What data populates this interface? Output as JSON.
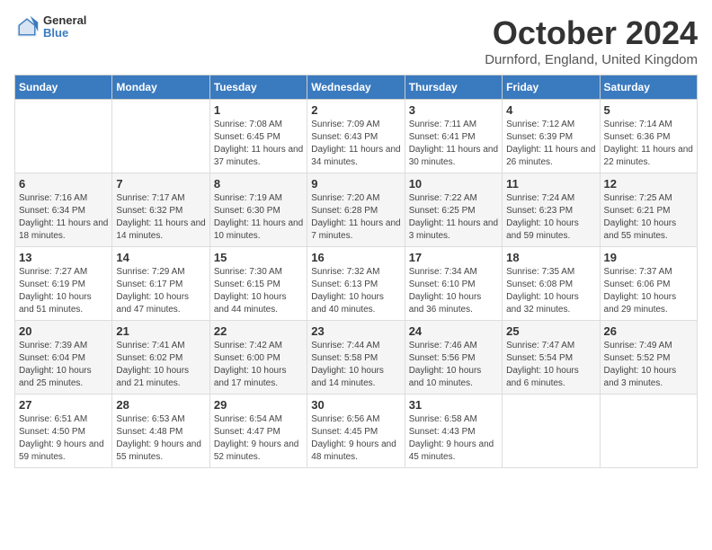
{
  "header": {
    "logo_line1": "General",
    "logo_line2": "Blue",
    "month_title": "October 2024",
    "location": "Durnford, England, United Kingdom"
  },
  "weekdays": [
    "Sunday",
    "Monday",
    "Tuesday",
    "Wednesday",
    "Thursday",
    "Friday",
    "Saturday"
  ],
  "weeks": [
    [
      {
        "day": "",
        "info": ""
      },
      {
        "day": "",
        "info": ""
      },
      {
        "day": "1",
        "info": "Sunrise: 7:08 AM\nSunset: 6:45 PM\nDaylight: 11 hours and 37 minutes."
      },
      {
        "day": "2",
        "info": "Sunrise: 7:09 AM\nSunset: 6:43 PM\nDaylight: 11 hours and 34 minutes."
      },
      {
        "day": "3",
        "info": "Sunrise: 7:11 AM\nSunset: 6:41 PM\nDaylight: 11 hours and 30 minutes."
      },
      {
        "day": "4",
        "info": "Sunrise: 7:12 AM\nSunset: 6:39 PM\nDaylight: 11 hours and 26 minutes."
      },
      {
        "day": "5",
        "info": "Sunrise: 7:14 AM\nSunset: 6:36 PM\nDaylight: 11 hours and 22 minutes."
      }
    ],
    [
      {
        "day": "6",
        "info": "Sunrise: 7:16 AM\nSunset: 6:34 PM\nDaylight: 11 hours and 18 minutes."
      },
      {
        "day": "7",
        "info": "Sunrise: 7:17 AM\nSunset: 6:32 PM\nDaylight: 11 hours and 14 minutes."
      },
      {
        "day": "8",
        "info": "Sunrise: 7:19 AM\nSunset: 6:30 PM\nDaylight: 11 hours and 10 minutes."
      },
      {
        "day": "9",
        "info": "Sunrise: 7:20 AM\nSunset: 6:28 PM\nDaylight: 11 hours and 7 minutes."
      },
      {
        "day": "10",
        "info": "Sunrise: 7:22 AM\nSunset: 6:25 PM\nDaylight: 11 hours and 3 minutes."
      },
      {
        "day": "11",
        "info": "Sunrise: 7:24 AM\nSunset: 6:23 PM\nDaylight: 10 hours and 59 minutes."
      },
      {
        "day": "12",
        "info": "Sunrise: 7:25 AM\nSunset: 6:21 PM\nDaylight: 10 hours and 55 minutes."
      }
    ],
    [
      {
        "day": "13",
        "info": "Sunrise: 7:27 AM\nSunset: 6:19 PM\nDaylight: 10 hours and 51 minutes."
      },
      {
        "day": "14",
        "info": "Sunrise: 7:29 AM\nSunset: 6:17 PM\nDaylight: 10 hours and 47 minutes."
      },
      {
        "day": "15",
        "info": "Sunrise: 7:30 AM\nSunset: 6:15 PM\nDaylight: 10 hours and 44 minutes."
      },
      {
        "day": "16",
        "info": "Sunrise: 7:32 AM\nSunset: 6:13 PM\nDaylight: 10 hours and 40 minutes."
      },
      {
        "day": "17",
        "info": "Sunrise: 7:34 AM\nSunset: 6:10 PM\nDaylight: 10 hours and 36 minutes."
      },
      {
        "day": "18",
        "info": "Sunrise: 7:35 AM\nSunset: 6:08 PM\nDaylight: 10 hours and 32 minutes."
      },
      {
        "day": "19",
        "info": "Sunrise: 7:37 AM\nSunset: 6:06 PM\nDaylight: 10 hours and 29 minutes."
      }
    ],
    [
      {
        "day": "20",
        "info": "Sunrise: 7:39 AM\nSunset: 6:04 PM\nDaylight: 10 hours and 25 minutes."
      },
      {
        "day": "21",
        "info": "Sunrise: 7:41 AM\nSunset: 6:02 PM\nDaylight: 10 hours and 21 minutes."
      },
      {
        "day": "22",
        "info": "Sunrise: 7:42 AM\nSunset: 6:00 PM\nDaylight: 10 hours and 17 minutes."
      },
      {
        "day": "23",
        "info": "Sunrise: 7:44 AM\nSunset: 5:58 PM\nDaylight: 10 hours and 14 minutes."
      },
      {
        "day": "24",
        "info": "Sunrise: 7:46 AM\nSunset: 5:56 PM\nDaylight: 10 hours and 10 minutes."
      },
      {
        "day": "25",
        "info": "Sunrise: 7:47 AM\nSunset: 5:54 PM\nDaylight: 10 hours and 6 minutes."
      },
      {
        "day": "26",
        "info": "Sunrise: 7:49 AM\nSunset: 5:52 PM\nDaylight: 10 hours and 3 minutes."
      }
    ],
    [
      {
        "day": "27",
        "info": "Sunrise: 6:51 AM\nSunset: 4:50 PM\nDaylight: 9 hours and 59 minutes."
      },
      {
        "day": "28",
        "info": "Sunrise: 6:53 AM\nSunset: 4:48 PM\nDaylight: 9 hours and 55 minutes."
      },
      {
        "day": "29",
        "info": "Sunrise: 6:54 AM\nSunset: 4:47 PM\nDaylight: 9 hours and 52 minutes."
      },
      {
        "day": "30",
        "info": "Sunrise: 6:56 AM\nSunset: 4:45 PM\nDaylight: 9 hours and 48 minutes."
      },
      {
        "day": "31",
        "info": "Sunrise: 6:58 AM\nSunset: 4:43 PM\nDaylight: 9 hours and 45 minutes."
      },
      {
        "day": "",
        "info": ""
      },
      {
        "day": "",
        "info": ""
      }
    ]
  ]
}
